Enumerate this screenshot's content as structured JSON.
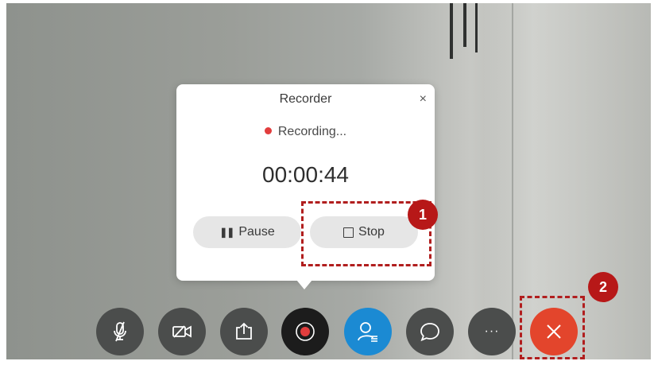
{
  "dialog": {
    "title": "Recorder",
    "close_glyph": "×",
    "status": "Recording...",
    "timer": "00:00:44",
    "pause_label": "Pause",
    "stop_label": "Stop"
  },
  "annotations": {
    "badge1": "1",
    "badge2": "2"
  },
  "toolbar": {
    "more_glyph": "···",
    "items": [
      {
        "icon": "mic-muted-icon"
      },
      {
        "icon": "video-off-icon"
      },
      {
        "icon": "share-icon"
      },
      {
        "icon": "record-icon"
      },
      {
        "icon": "participants-icon"
      },
      {
        "icon": "chat-icon"
      },
      {
        "icon": "more-icon"
      },
      {
        "icon": "end-call-icon"
      }
    ]
  },
  "colors": {
    "record_dot": "#e23d3d",
    "participants_bg": "#1b8ad3",
    "end_call_bg": "#e3452c",
    "annotation": "#b11e1e"
  }
}
